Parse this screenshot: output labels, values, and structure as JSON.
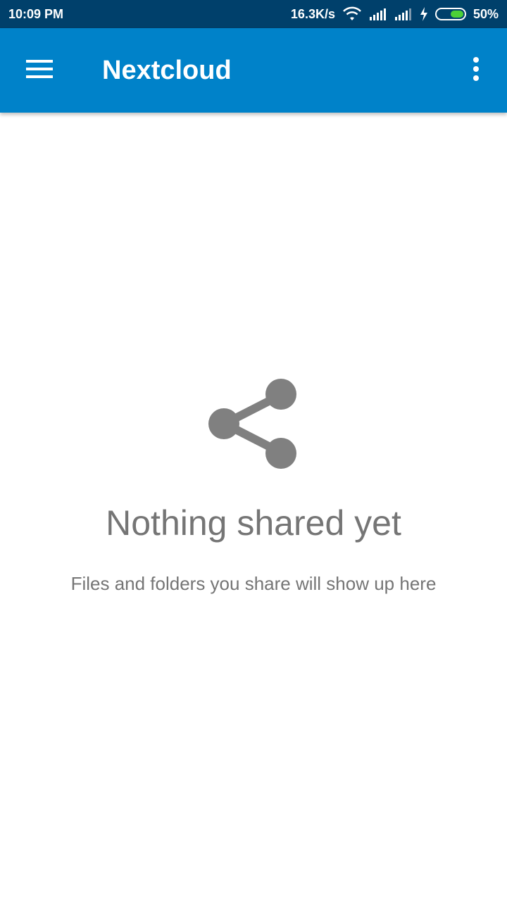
{
  "status_bar": {
    "time": "10:09 PM",
    "network_speed": "16.3K/s",
    "battery_percent": "50%",
    "battery_level": 0.5,
    "icons": [
      "wifi-icon",
      "signal-icon",
      "signal-icon",
      "charging-icon",
      "battery-icon"
    ]
  },
  "app_bar": {
    "title": "Nextcloud",
    "background_color": "#0082c9",
    "menu_icon": "hamburger-menu-icon",
    "overflow_icon": "more-vert-icon"
  },
  "empty_state": {
    "icon": "share-icon",
    "title": "Nothing shared yet",
    "subtitle": "Files and folders you share will show up here",
    "text_color": "#757575"
  }
}
